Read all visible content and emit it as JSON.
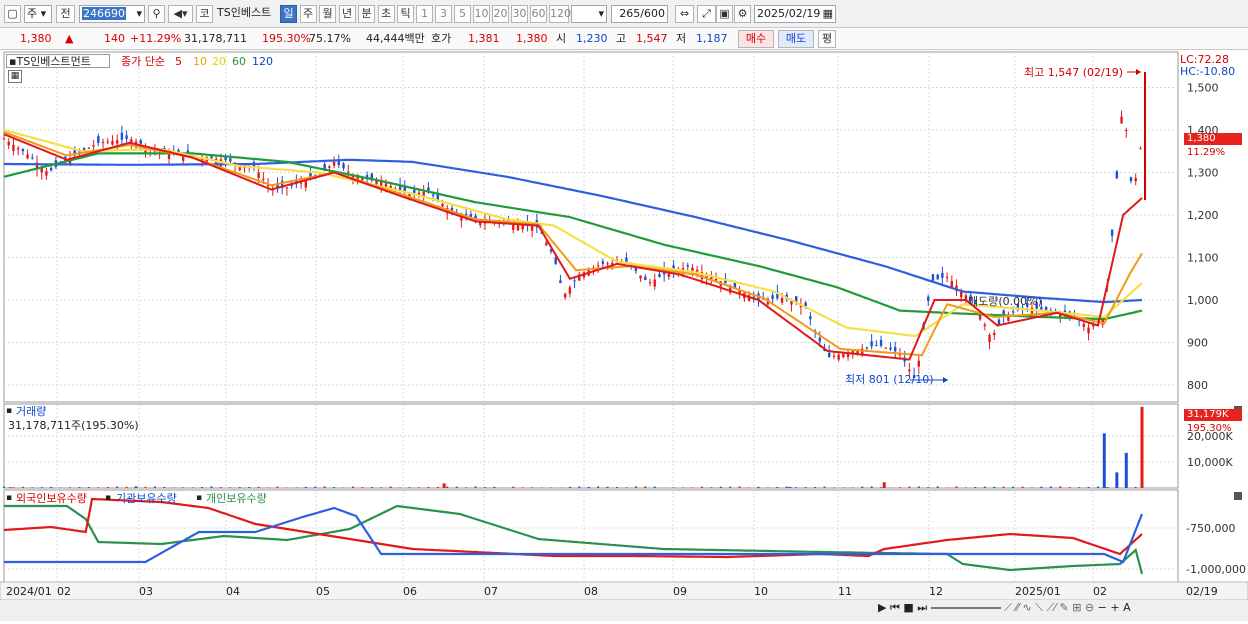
{
  "toolbar": {
    "market_type": "주",
    "prev": "전",
    "code": "246690",
    "co_prefix": "코",
    "stock_name": "TS인베스트",
    "periods": [
      "일",
      "주",
      "월",
      "년",
      "분",
      "초",
      "틱"
    ],
    "selected_period": "일",
    "intervals": [
      "1",
      "3",
      "5",
      "10",
      "20",
      "30",
      "60",
      "120"
    ],
    "count": "265",
    "max_count": "/600",
    "date": "2025/02/19"
  },
  "quote": {
    "price": "1,380",
    "change": "140",
    "change_pct": "+11.29%",
    "volume": "31,178,711",
    "vol_ratio": "195.30%",
    "rate2": "75.17%",
    "amount": "44,444백만",
    "bid_label": "호가",
    "bid1": "1,381",
    "bid2": "1,380",
    "open_label": "시",
    "open": "1,230",
    "high_label": "고",
    "high": "1,547",
    "low_label": "저",
    "low": "1,187",
    "buy": "매수",
    "sell": "매도",
    "eval": "평"
  },
  "price_panel": {
    "name": "TS인베스트먼트",
    "ma_label": "종가 단순",
    "ma_periods": [
      "5",
      "10",
      "20",
      "60",
      "120"
    ],
    "lc": "LC:72.28",
    "hc": "HC:-10.80",
    "high_note": "최고 1,547 (02/19)",
    "low_note": "최저 801 (12/10)",
    "mid_note": "매도량(0.00%)",
    "cur_price": "1,380",
    "cur_pct": "11.29%"
  },
  "volume_panel": {
    "title": "거래량",
    "value": "31,178,711주(195.30%)",
    "cur": "31,179K",
    "cur_pct": "195.30%"
  },
  "holding_panel": {
    "foreign": "외국인보유수량",
    "inst": "기관보유수량",
    "indiv": "개인보유수량"
  },
  "x_axis": {
    "labels": [
      "2024/01",
      "02",
      "03",
      "04",
      "05",
      "06",
      "07",
      "08",
      "09",
      "10",
      "11",
      "12",
      "2025/01",
      "02"
    ],
    "last": "02/19"
  },
  "chart_data": {
    "type": "candlestick",
    "stock": "TS인베스트먼트",
    "x_months": [
      "2024/01",
      "02",
      "03",
      "04",
      "05",
      "06",
      "07",
      "08",
      "09",
      "10",
      "11",
      "12",
      "2025/01",
      "02"
    ],
    "price_axis": {
      "ticks": [
        800,
        900,
        1000,
        1100,
        1200,
        1300,
        1400,
        1500
      ],
      "range": [
        760,
        1560
      ]
    },
    "volume_axis": {
      "ticks": [
        "10,000K",
        "20,000K"
      ],
      "range": [
        0,
        31500
      ]
    },
    "holdings_axis": {
      "ticks": [
        "-750,000",
        "-1,000,000"
      ]
    },
    "close_path": [
      [
        0,
        1380
      ],
      [
        8,
        1340
      ],
      [
        14,
        1300
      ],
      [
        20,
        1330
      ],
      [
        30,
        1370
      ],
      [
        40,
        1380
      ],
      [
        50,
        1345
      ],
      [
        60,
        1340
      ],
      [
        70,
        1330
      ],
      [
        80,
        1310
      ],
      [
        85,
        1260
      ],
      [
        90,
        1265
      ],
      [
        100,
        1290
      ],
      [
        105,
        1325
      ],
      [
        112,
        1290
      ],
      [
        120,
        1280
      ],
      [
        128,
        1250
      ],
      [
        135,
        1255
      ],
      [
        142,
        1210
      ],
      [
        150,
        1185
      ],
      [
        158,
        1185
      ],
      [
        165,
        1180
      ],
      [
        170,
        1170
      ],
      [
        175,
        1100
      ],
      [
        178,
        1010
      ],
      [
        183,
        1060
      ],
      [
        190,
        1085
      ],
      [
        198,
        1090
      ],
      [
        205,
        1040
      ],
      [
        210,
        1060
      ],
      [
        218,
        1080
      ],
      [
        225,
        1055
      ],
      [
        232,
        1030
      ],
      [
        240,
        1000
      ],
      [
        248,
        1005
      ],
      [
        255,
        985
      ],
      [
        258,
        925
      ],
      [
        262,
        865
      ],
      [
        270,
        880
      ],
      [
        278,
        895
      ],
      [
        285,
        875
      ],
      [
        290,
        810
      ],
      [
        295,
        1045
      ],
      [
        300,
        1055
      ],
      [
        305,
        1020
      ],
      [
        310,
        975
      ],
      [
        314,
        910
      ],
      [
        318,
        960
      ],
      [
        325,
        985
      ],
      [
        332,
        975
      ],
      [
        340,
        965
      ],
      [
        345,
        935
      ],
      [
        350,
        955
      ],
      [
        353,
        1190
      ],
      [
        356,
        1480
      ],
      [
        359,
        1240
      ],
      [
        362,
        1380
      ]
    ],
    "ma5": [
      [
        0,
        1390
      ],
      [
        20,
        1330
      ],
      [
        40,
        1370
      ],
      [
        60,
        1335
      ],
      [
        85,
        1260
      ],
      [
        105,
        1300
      ],
      [
        128,
        1240
      ],
      [
        150,
        1185
      ],
      [
        170,
        1175
      ],
      [
        180,
        1050
      ],
      [
        195,
        1085
      ],
      [
        215,
        1060
      ],
      [
        240,
        1000
      ],
      [
        262,
        880
      ],
      [
        288,
        860
      ],
      [
        296,
        1000
      ],
      [
        306,
        1000
      ],
      [
        316,
        940
      ],
      [
        335,
        970
      ],
      [
        348,
        940
      ],
      [
        356,
        1200
      ],
      [
        362,
        1240
      ]
    ],
    "ma10": [
      [
        0,
        1395
      ],
      [
        20,
        1340
      ],
      [
        40,
        1365
      ],
      [
        60,
        1335
      ],
      [
        85,
        1270
      ],
      [
        105,
        1300
      ],
      [
        128,
        1245
      ],
      [
        150,
        1190
      ],
      [
        170,
        1178
      ],
      [
        182,
        1070
      ],
      [
        200,
        1080
      ],
      [
        220,
        1060
      ],
      [
        242,
        1003
      ],
      [
        266,
        885
      ],
      [
        292,
        870
      ],
      [
        300,
        990
      ],
      [
        315,
        960
      ],
      [
        335,
        970
      ],
      [
        350,
        945
      ],
      [
        358,
        1060
      ],
      [
        362,
        1110
      ]
    ],
    "ma20": [
      [
        0,
        1400
      ],
      [
        25,
        1350
      ],
      [
        50,
        1355
      ],
      [
        75,
        1315
      ],
      [
        100,
        1300
      ],
      [
        130,
        1250
      ],
      [
        160,
        1190
      ],
      [
        175,
        1175
      ],
      [
        195,
        1090
      ],
      [
        220,
        1065
      ],
      [
        245,
        1020
      ],
      [
        268,
        935
      ],
      [
        290,
        915
      ],
      [
        305,
        990
      ],
      [
        330,
        975
      ],
      [
        350,
        960
      ],
      [
        362,
        1040
      ]
    ],
    "ma60": [
      [
        0,
        1290
      ],
      [
        30,
        1345
      ],
      [
        60,
        1345
      ],
      [
        90,
        1325
      ],
      [
        120,
        1280
      ],
      [
        150,
        1230
      ],
      [
        180,
        1195
      ],
      [
        210,
        1130
      ],
      [
        240,
        1080
      ],
      [
        265,
        1030
      ],
      [
        285,
        975
      ],
      [
        305,
        968
      ],
      [
        330,
        960
      ],
      [
        350,
        955
      ],
      [
        362,
        975
      ]
    ],
    "ma120": [
      [
        0,
        1320
      ],
      [
        40,
        1318
      ],
      [
        80,
        1320
      ],
      [
        110,
        1330
      ],
      [
        130,
        1325
      ],
      [
        160,
        1290
      ],
      [
        190,
        1245
      ],
      [
        220,
        1195
      ],
      [
        250,
        1140
      ],
      [
        280,
        1080
      ],
      [
        305,
        1020
      ],
      [
        330,
        1005
      ],
      [
        350,
        995
      ],
      [
        362,
        1000
      ]
    ],
    "volume_spikes": [
      [
        2,
        300
      ],
      [
        42,
        600
      ],
      [
        140,
        1800
      ],
      [
        250,
        400
      ],
      [
        280,
        2200
      ],
      [
        350,
        21000
      ],
      [
        354,
        6000
      ],
      [
        357,
        13500
      ],
      [
        362,
        31179
      ]
    ],
    "holdings_red": [
      [
        0,
        36
      ],
      [
        15,
        33
      ],
      [
        26,
        38
      ],
      [
        28,
        5
      ],
      [
        50,
        8
      ],
      [
        65,
        14
      ],
      [
        80,
        30
      ],
      [
        110,
        45
      ],
      [
        130,
        55
      ],
      [
        150,
        58
      ],
      [
        175,
        62
      ],
      [
        200,
        62
      ],
      [
        230,
        63
      ],
      [
        260,
        60
      ],
      [
        275,
        62
      ],
      [
        280,
        55
      ],
      [
        300,
        46
      ],
      [
        320,
        40
      ],
      [
        340,
        44
      ],
      [
        355,
        60
      ],
      [
        362,
        40
      ]
    ],
    "holdings_blue": [
      [
        0,
        68
      ],
      [
        45,
        68
      ],
      [
        54,
        52
      ],
      [
        62,
        38
      ],
      [
        80,
        38
      ],
      [
        95,
        23
      ],
      [
        105,
        14
      ],
      [
        112,
        22
      ],
      [
        120,
        60
      ],
      [
        150,
        60
      ],
      [
        250,
        60
      ],
      [
        300,
        60
      ],
      [
        350,
        60
      ],
      [
        356,
        68
      ],
      [
        362,
        20
      ]
    ],
    "holdings_green": [
      [
        0,
        12
      ],
      [
        20,
        12
      ],
      [
        26,
        25
      ],
      [
        30,
        48
      ],
      [
        50,
        50
      ],
      [
        70,
        42
      ],
      [
        90,
        46
      ],
      [
        110,
        35
      ],
      [
        125,
        12
      ],
      [
        145,
        20
      ],
      [
        170,
        45
      ],
      [
        210,
        55
      ],
      [
        260,
        58
      ],
      [
        300,
        60
      ],
      [
        305,
        70
      ],
      [
        320,
        76
      ],
      [
        340,
        72
      ],
      [
        355,
        70
      ],
      [
        360,
        56
      ],
      [
        362,
        80
      ]
    ]
  }
}
